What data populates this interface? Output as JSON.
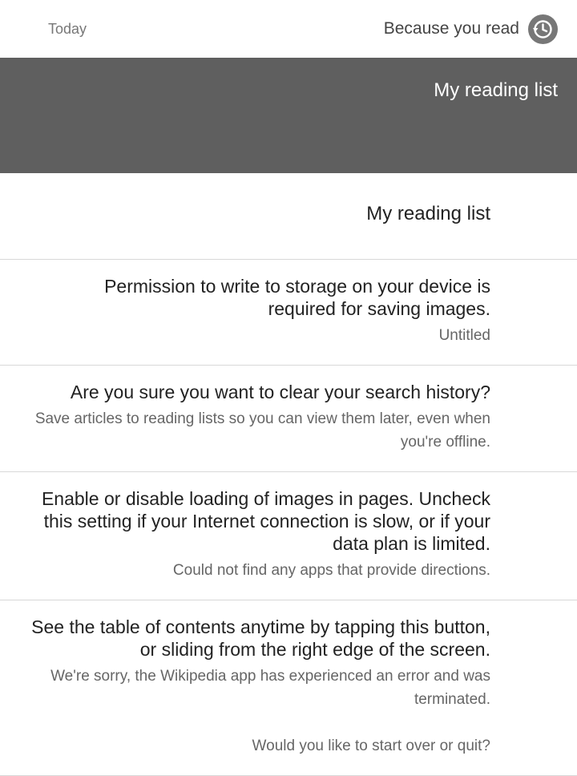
{
  "top_bar": {
    "left_label": "Today",
    "right_label": "Because you read",
    "history_icon": "history-icon"
  },
  "header": {
    "title": "My reading list",
    "band_color": "#5f5f5f"
  },
  "list_header": {
    "title": "My reading list"
  },
  "items": [
    {
      "primary": "Permission to write to storage on your device is required for saving images.",
      "secondary": "Untitled"
    },
    {
      "primary": "Are you sure you want to clear your search history?",
      "secondary": "Save articles to reading lists so you can view them later, even when you're offline."
    },
    {
      "primary": "Enable or disable loading of images in pages. Uncheck this setting if your Internet connection is slow, or if your data plan is limited.",
      "secondary": "Could not find any apps that provide directions."
    },
    {
      "primary": "See the table of contents anytime by tapping this button, or sliding from the right edge of the screen.",
      "secondary": "We're sorry, the Wikipedia app has experienced an error and was terminated.",
      "secondary_extra": "Would you like to start over or quit?"
    }
  ]
}
